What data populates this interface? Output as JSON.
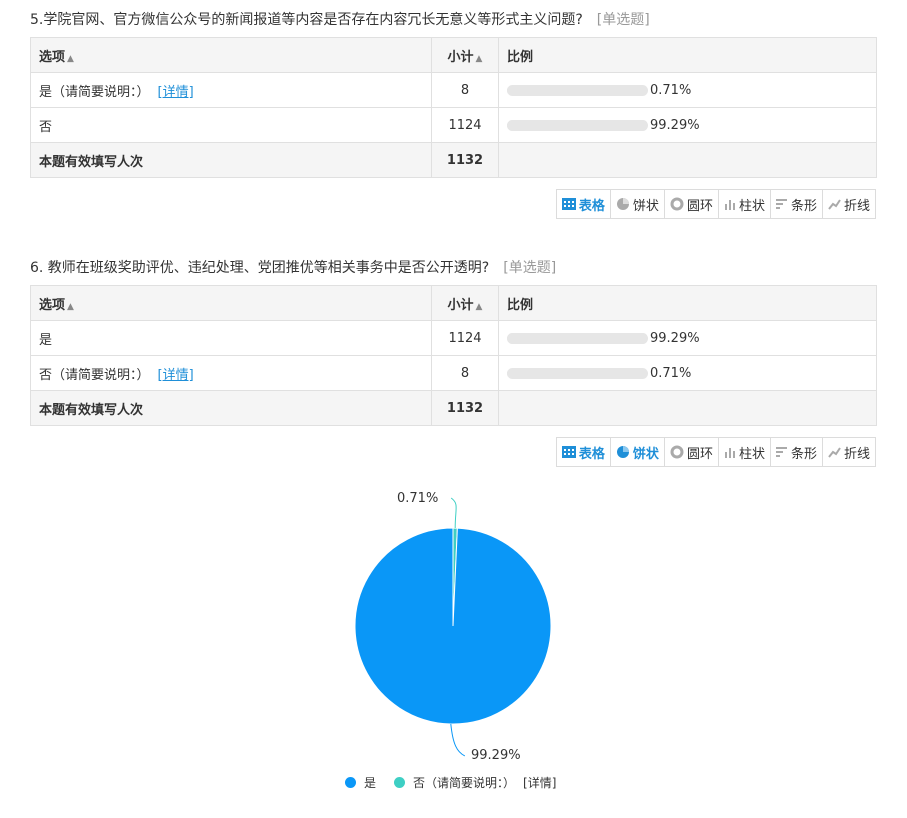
{
  "q5": {
    "title": "5.学院官网、官方微信公众号的新闻报道等内容是否存在内容冗长无意义等形式主义问题?",
    "type": "[单选题]",
    "headers": {
      "option": "选项",
      "count": "小计",
      "ratio": "比例"
    },
    "rows": [
      {
        "label": "是（请简要说明：）",
        "detail": "[详情]",
        "count": "8",
        "pct": "0.71%",
        "value": 0.71
      },
      {
        "label": "否",
        "detail": "",
        "count": "1124",
        "pct": "99.29%",
        "value": 99.29
      }
    ],
    "total_label": "本题有效填写人次",
    "total_count": "1132"
  },
  "q6": {
    "title": "6. 教师在班级奖助评优、违纪处理、党团推优等相关事务中是否公开透明?",
    "type": "[单选题]",
    "headers": {
      "option": "选项",
      "count": "小计",
      "ratio": "比例"
    },
    "rows": [
      {
        "label": "是",
        "detail": "",
        "count": "1124",
        "pct": "99.29%",
        "value": 99.29
      },
      {
        "label": "否（请简要说明：）",
        "detail": "[详情]",
        "count": "8",
        "pct": "0.71%",
        "value": 0.71
      }
    ],
    "total_label": "本题有效填写人次",
    "total_count": "1132"
  },
  "tabs": {
    "table": "表格",
    "pie": "饼状",
    "ring": "圆环",
    "column": "柱状",
    "bar": "条形",
    "line": "折线"
  },
  "chart_data": {
    "type": "pie",
    "categories": [
      "是",
      "否（请简要说明：）"
    ],
    "values": [
      99.29,
      0.71
    ],
    "labels": [
      "99.29%",
      "0.71%"
    ],
    "colors": [
      "#0a97f7",
      "#3ecfc4"
    ],
    "legend": [
      {
        "name": "是",
        "color": "#0a97f7"
      },
      {
        "name": "否（请简要说明：）",
        "suffix": "[详情]",
        "color": "#3ecfc4"
      }
    ],
    "legend_position": "bottom"
  }
}
